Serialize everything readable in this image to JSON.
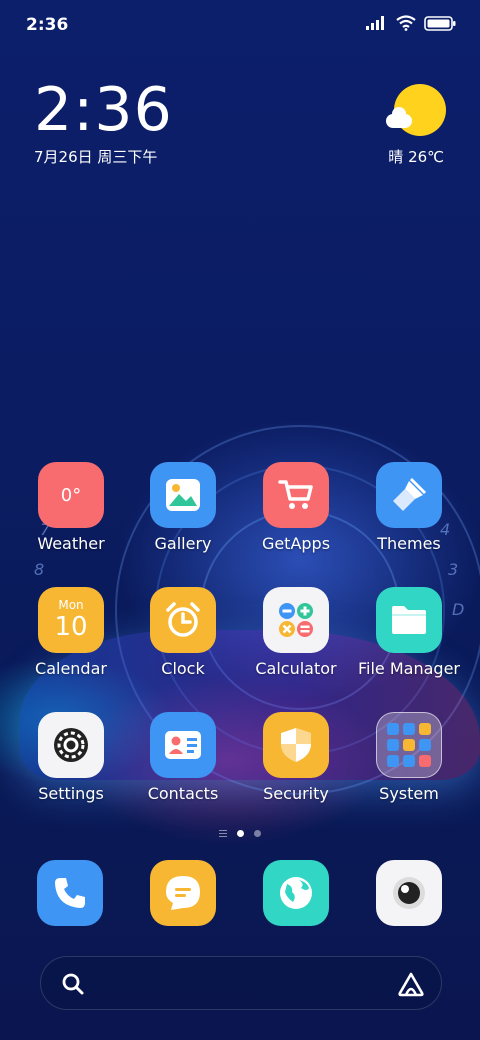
{
  "status_bar": {
    "time": "2:36",
    "icons": [
      "signal-icon",
      "wifi-icon",
      "battery-icon"
    ]
  },
  "clock_widget": {
    "time": "2:36",
    "date": "7月26日 周三下午"
  },
  "weather_widget": {
    "icon": "sun-cloud-icon",
    "text": "晴 26℃"
  },
  "apps": [
    {
      "label": "Weather",
      "icon": "weather-icon",
      "icon_text": "0°",
      "color": "#f86b6e"
    },
    {
      "label": "Gallery",
      "icon": "gallery-icon",
      "color": "#3f95f3"
    },
    {
      "label": "GetApps",
      "icon": "getapps-cart-icon",
      "color": "#f86b6e"
    },
    {
      "label": "Themes",
      "icon": "themes-brush-icon",
      "color": "#3f95f3"
    },
    {
      "label": "Calendar",
      "icon": "calendar-icon",
      "icon_small": "Mon",
      "icon_big": "10",
      "color": "#f7b733"
    },
    {
      "label": "Clock",
      "icon": "alarm-clock-icon",
      "color": "#f7b733"
    },
    {
      "label": "Calculator",
      "icon": "calculator-icon",
      "color": "#f4f4f6"
    },
    {
      "label": "File Manager",
      "icon": "folder-icon",
      "color": "#31d6c4"
    },
    {
      "label": "Settings",
      "icon": "gear-icon",
      "color": "#f4f4f6"
    },
    {
      "label": "Contacts",
      "icon": "contact-card-icon",
      "color": "#3f95f3"
    },
    {
      "label": "Security",
      "icon": "shield-icon",
      "color": "#f7b733"
    },
    {
      "label": "System",
      "icon": "folder-group-icon",
      "color": "#ffffff"
    }
  ],
  "page_indicator": {
    "pages": 2,
    "active": 0
  },
  "dock": [
    {
      "name": "phone",
      "icon": "phone-icon",
      "color": "#3f95f3"
    },
    {
      "name": "messages",
      "icon": "message-icon",
      "color": "#f7b733"
    },
    {
      "name": "browser",
      "icon": "browser-globe-icon",
      "color": "#31d6c4"
    },
    {
      "name": "camera",
      "icon": "camera-icon",
      "color": "#f4f4f6"
    }
  ],
  "search_bar": {
    "left_icon": "search-icon",
    "right_icon": "assistant-icon"
  }
}
